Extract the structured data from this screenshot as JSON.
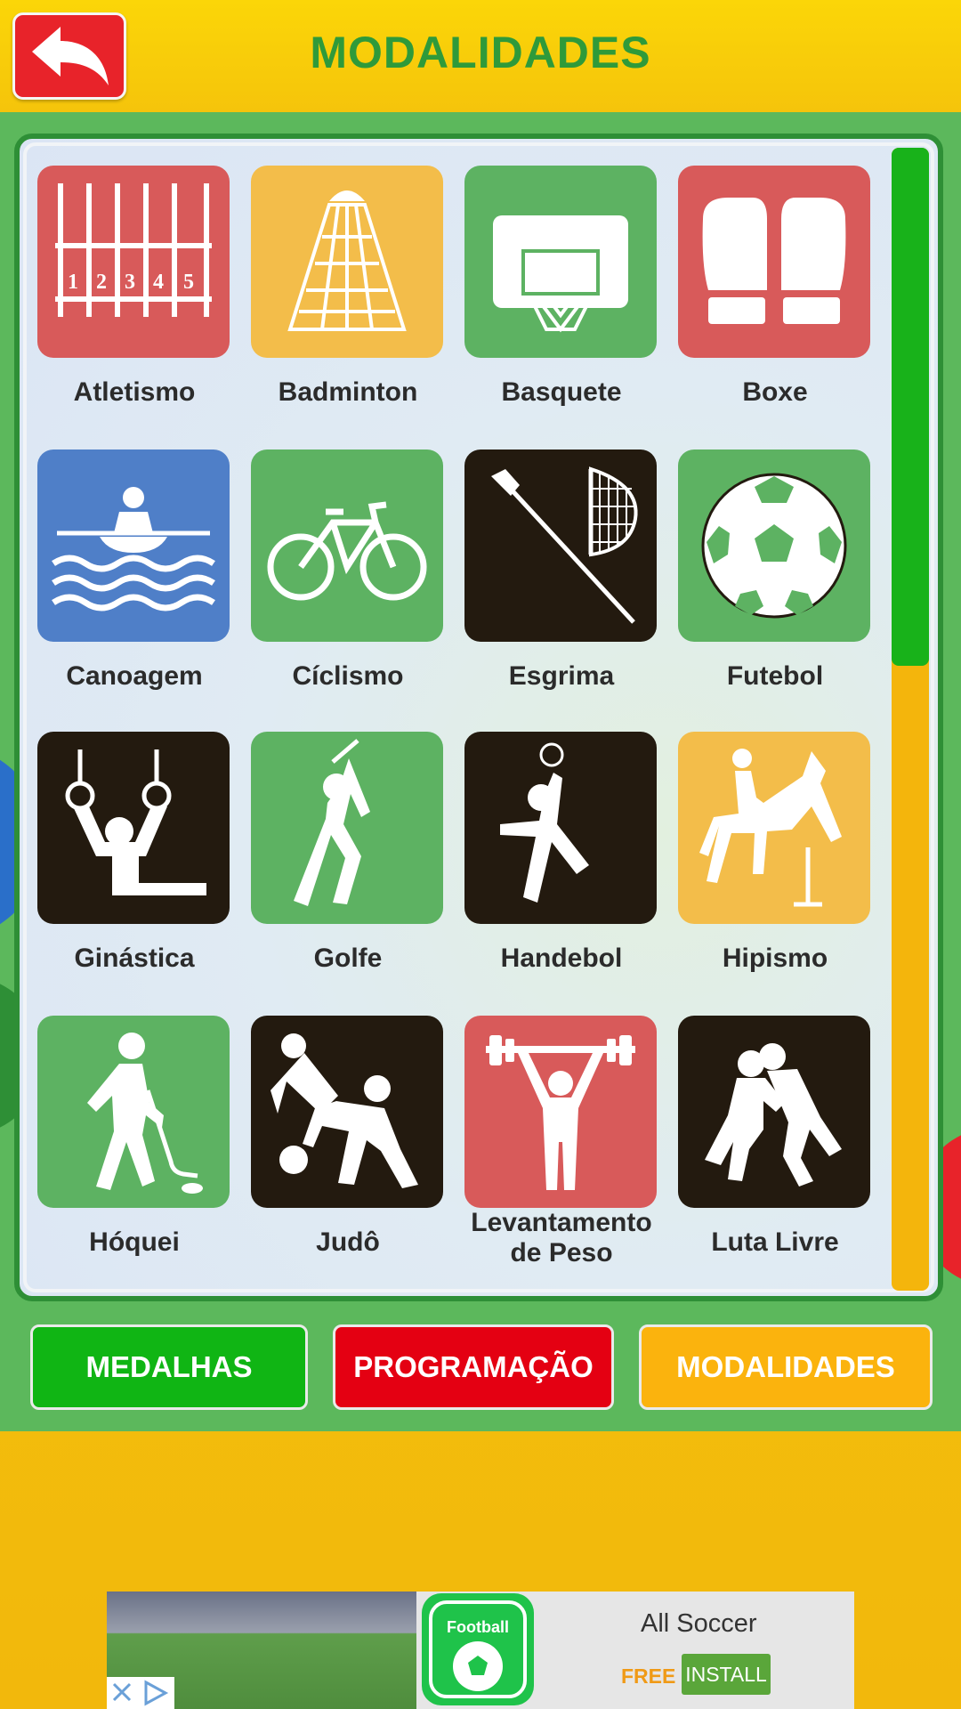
{
  "header": {
    "title": "MODALIDADES",
    "back_icon": "undo-arrow-icon"
  },
  "colors": {
    "red": "#d85a5a",
    "yellow": "#f3bd4a",
    "green": "#5db262",
    "blue": "#4f7fc8",
    "dark": "#231a0f",
    "nav_medalhas": "#10b514",
    "nav_programacao": "#e40012",
    "nav_modalidades": "#fbb30d"
  },
  "sports": [
    {
      "label": "Atletismo",
      "icon": "track-lanes-icon",
      "bg": "red"
    },
    {
      "label": "Badminton",
      "icon": "shuttlecock-icon",
      "bg": "yellow"
    },
    {
      "label": "Basquete",
      "icon": "basketball-hoop-icon",
      "bg": "green"
    },
    {
      "label": "Boxe",
      "icon": "boxing-gloves-icon",
      "bg": "red"
    },
    {
      "label": "Canoagem",
      "icon": "canoe-icon",
      "bg": "blue"
    },
    {
      "label": "Cíclismo",
      "icon": "bicycle-icon",
      "bg": "green"
    },
    {
      "label": "Esgrima",
      "icon": "fencing-icon",
      "bg": "dark"
    },
    {
      "label": "Futebol",
      "icon": "soccer-ball-icon",
      "bg": "green"
    },
    {
      "label": "Ginástica",
      "icon": "gymnastics-rings-icon",
      "bg": "dark"
    },
    {
      "label": "Golfe",
      "icon": "golfer-icon",
      "bg": "green"
    },
    {
      "label": "Handebol",
      "icon": "handball-player-icon",
      "bg": "dark"
    },
    {
      "label": "Hipismo",
      "icon": "horse-jumping-icon",
      "bg": "yellow"
    },
    {
      "label": "Hóquei",
      "icon": "hockey-player-icon",
      "bg": "green"
    },
    {
      "label": "Judô",
      "icon": "judo-icon",
      "bg": "dark"
    },
    {
      "label": "Levantamento\nde Peso",
      "icon": "weightlifting-icon",
      "bg": "red"
    },
    {
      "label": "Luta Livre",
      "icon": "wrestling-icon",
      "bg": "dark"
    }
  ],
  "nav": {
    "medalhas": "MEDALHAS",
    "programacao": "PROGRAMAÇÃO",
    "modalidades": "MODALIDADES"
  },
  "ad": {
    "icon_label": "Football",
    "title": "All Soccer",
    "free": "FREE",
    "install": "INSTALL"
  }
}
